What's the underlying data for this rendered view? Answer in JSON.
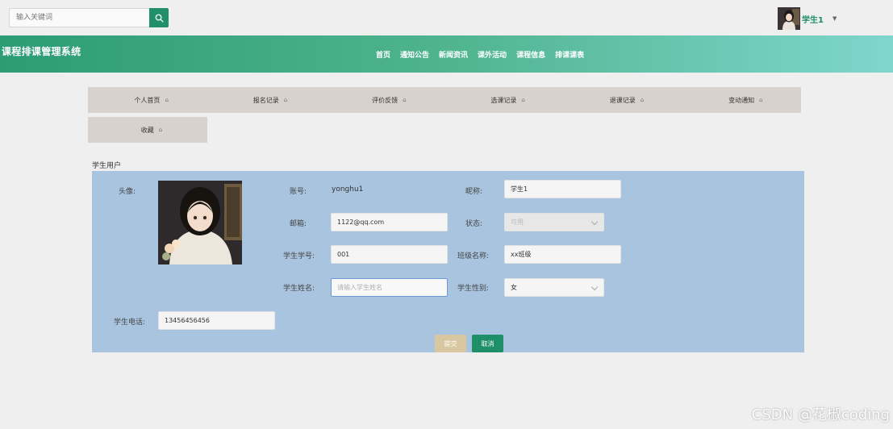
{
  "search": {
    "placeholder": "输入关键词"
  },
  "user": {
    "name": "学生1"
  },
  "header": {
    "site_title": "课程排课管理系统",
    "nav": [
      "首页",
      "通知公告",
      "新闻资讯",
      "课外活动",
      "课程信息",
      "排课课表"
    ]
  },
  "subtabs": [
    "个人首页",
    "报名记录",
    "评价反馈",
    "选课记录",
    "退课记录",
    "变动通知",
    "收藏"
  ],
  "section_title": "学生用户",
  "form": {
    "avatar_label": "头像:",
    "account_label": "账号:",
    "account_value": "yonghu1",
    "nickname_label": "昵称:",
    "nickname_value": "学生1",
    "email_label": "邮箱:",
    "email_value": "1122@qq.com",
    "status_label": "状态:",
    "status_value": "可用",
    "student_no_label": "学生学号:",
    "student_no_value": "001",
    "class_label": "班级名称:",
    "class_value": "xx班级",
    "student_name_label": "学生姓名:",
    "student_name_placeholder": "请输入学生姓名",
    "gender_label": "学生性别:",
    "gender_value": "女",
    "phone_label": "学生电话:",
    "phone_value": "13456456456",
    "submit_label": "提交",
    "cancel_label": "取消"
  },
  "watermark": "CSDN @花椒coding",
  "colors": {
    "accent": "#20906b",
    "panel": "#a8c4de",
    "tab_bg": "#d8d1cc"
  }
}
